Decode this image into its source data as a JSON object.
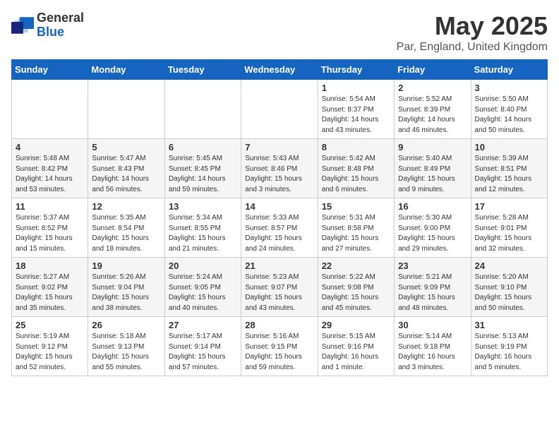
{
  "header": {
    "logo_general": "General",
    "logo_blue": "Blue",
    "title": "May 2025",
    "subtitle": "Par, England, United Kingdom"
  },
  "days_of_week": [
    "Sunday",
    "Monday",
    "Tuesday",
    "Wednesday",
    "Thursday",
    "Friday",
    "Saturday"
  ],
  "weeks": [
    [
      {
        "day": "",
        "info": ""
      },
      {
        "day": "",
        "info": ""
      },
      {
        "day": "",
        "info": ""
      },
      {
        "day": "",
        "info": ""
      },
      {
        "day": "1",
        "info": "Sunrise: 5:54 AM\nSunset: 8:37 PM\nDaylight: 14 hours\nand 43 minutes."
      },
      {
        "day": "2",
        "info": "Sunrise: 5:52 AM\nSunset: 8:39 PM\nDaylight: 14 hours\nand 46 minutes."
      },
      {
        "day": "3",
        "info": "Sunrise: 5:50 AM\nSunset: 8:40 PM\nDaylight: 14 hours\nand 50 minutes."
      }
    ],
    [
      {
        "day": "4",
        "info": "Sunrise: 5:48 AM\nSunset: 8:42 PM\nDaylight: 14 hours\nand 53 minutes."
      },
      {
        "day": "5",
        "info": "Sunrise: 5:47 AM\nSunset: 8:43 PM\nDaylight: 14 hours\nand 56 minutes."
      },
      {
        "day": "6",
        "info": "Sunrise: 5:45 AM\nSunset: 8:45 PM\nDaylight: 14 hours\nand 59 minutes."
      },
      {
        "day": "7",
        "info": "Sunrise: 5:43 AM\nSunset: 8:46 PM\nDaylight: 15 hours\nand 3 minutes."
      },
      {
        "day": "8",
        "info": "Sunrise: 5:42 AM\nSunset: 8:48 PM\nDaylight: 15 hours\nand 6 minutes."
      },
      {
        "day": "9",
        "info": "Sunrise: 5:40 AM\nSunset: 8:49 PM\nDaylight: 15 hours\nand 9 minutes."
      },
      {
        "day": "10",
        "info": "Sunrise: 5:39 AM\nSunset: 8:51 PM\nDaylight: 15 hours\nand 12 minutes."
      }
    ],
    [
      {
        "day": "11",
        "info": "Sunrise: 5:37 AM\nSunset: 8:52 PM\nDaylight: 15 hours\nand 15 minutes."
      },
      {
        "day": "12",
        "info": "Sunrise: 5:35 AM\nSunset: 8:54 PM\nDaylight: 15 hours\nand 18 minutes."
      },
      {
        "day": "13",
        "info": "Sunrise: 5:34 AM\nSunset: 8:55 PM\nDaylight: 15 hours\nand 21 minutes."
      },
      {
        "day": "14",
        "info": "Sunrise: 5:33 AM\nSunset: 8:57 PM\nDaylight: 15 hours\nand 24 minutes."
      },
      {
        "day": "15",
        "info": "Sunrise: 5:31 AM\nSunset: 8:58 PM\nDaylight: 15 hours\nand 27 minutes."
      },
      {
        "day": "16",
        "info": "Sunrise: 5:30 AM\nSunset: 9:00 PM\nDaylight: 15 hours\nand 29 minutes."
      },
      {
        "day": "17",
        "info": "Sunrise: 5:28 AM\nSunset: 9:01 PM\nDaylight: 15 hours\nand 32 minutes."
      }
    ],
    [
      {
        "day": "18",
        "info": "Sunrise: 5:27 AM\nSunset: 9:02 PM\nDaylight: 15 hours\nand 35 minutes."
      },
      {
        "day": "19",
        "info": "Sunrise: 5:26 AM\nSunset: 9:04 PM\nDaylight: 15 hours\nand 38 minutes."
      },
      {
        "day": "20",
        "info": "Sunrise: 5:24 AM\nSunset: 9:05 PM\nDaylight: 15 hours\nand 40 minutes."
      },
      {
        "day": "21",
        "info": "Sunrise: 5:23 AM\nSunset: 9:07 PM\nDaylight: 15 hours\nand 43 minutes."
      },
      {
        "day": "22",
        "info": "Sunrise: 5:22 AM\nSunset: 9:08 PM\nDaylight: 15 hours\nand 45 minutes."
      },
      {
        "day": "23",
        "info": "Sunrise: 5:21 AM\nSunset: 9:09 PM\nDaylight: 15 hours\nand 48 minutes."
      },
      {
        "day": "24",
        "info": "Sunrise: 5:20 AM\nSunset: 9:10 PM\nDaylight: 15 hours\nand 50 minutes."
      }
    ],
    [
      {
        "day": "25",
        "info": "Sunrise: 5:19 AM\nSunset: 9:12 PM\nDaylight: 15 hours\nand 52 minutes."
      },
      {
        "day": "26",
        "info": "Sunrise: 5:18 AM\nSunset: 9:13 PM\nDaylight: 15 hours\nand 55 minutes."
      },
      {
        "day": "27",
        "info": "Sunrise: 5:17 AM\nSunset: 9:14 PM\nDaylight: 15 hours\nand 57 minutes."
      },
      {
        "day": "28",
        "info": "Sunrise: 5:16 AM\nSunset: 9:15 PM\nDaylight: 15 hours\nand 59 minutes."
      },
      {
        "day": "29",
        "info": "Sunrise: 5:15 AM\nSunset: 9:16 PM\nDaylight: 16 hours\nand 1 minute."
      },
      {
        "day": "30",
        "info": "Sunrise: 5:14 AM\nSunset: 9:18 PM\nDaylight: 16 hours\nand 3 minutes."
      },
      {
        "day": "31",
        "info": "Sunrise: 5:13 AM\nSunset: 9:19 PM\nDaylight: 16 hours\nand 5 minutes."
      }
    ]
  ]
}
